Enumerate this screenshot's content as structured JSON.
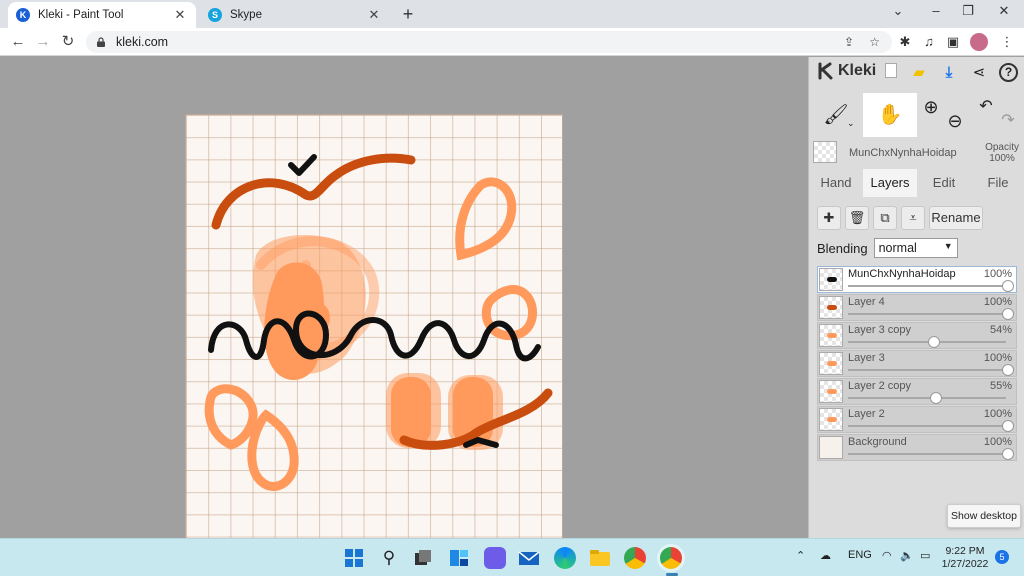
{
  "browser": {
    "tabs": [
      {
        "title": "Kleki - Paint Tool",
        "active": true,
        "icon": "kleki-icon"
      },
      {
        "title": "Skype",
        "active": false,
        "icon": "skype-icon"
      }
    ],
    "url": "kleki.com"
  },
  "app": {
    "logo": "Kleki",
    "layer_name_current": "MunChxNynhaHoidap",
    "opacity_label": "Opacity",
    "opacity_value": "100%",
    "tabs": [
      "Hand",
      "Layers",
      "Edit",
      "File"
    ],
    "active_tab": "Layers",
    "rename_label": "Rename",
    "blending_label": "Blending",
    "blending_value": "normal",
    "layers": [
      {
        "name": "MunChxNynhaHoidap",
        "opacity": "100%",
        "opacity_value": 1.0,
        "selected": true
      },
      {
        "name": "Layer 4",
        "opacity": "100%",
        "opacity_value": 1.0,
        "selected": false
      },
      {
        "name": "Layer 3 copy",
        "opacity": "54%",
        "opacity_value": 0.54,
        "selected": false
      },
      {
        "name": "Layer 3",
        "opacity": "100%",
        "opacity_value": 1.0,
        "selected": false
      },
      {
        "name": "Layer 2 copy",
        "opacity": "55%",
        "opacity_value": 0.55,
        "selected": false
      },
      {
        "name": "Layer 2",
        "opacity": "100%",
        "opacity_value": 1.0,
        "selected": false
      },
      {
        "name": "Background",
        "opacity": "100%",
        "opacity_value": 1.0,
        "selected": false
      }
    ]
  },
  "show_desktop": "Show desktop",
  "taskbar": {
    "language": "ENG",
    "time": "9:22 PM",
    "date": "1/27/2022",
    "notification_count": "5"
  },
  "colors": {
    "accent_orange": "#ff9a5c",
    "dark_orange": "#c94d0e",
    "stroke_black": "#111111",
    "taskbar_bg": "#c7e8ef"
  }
}
